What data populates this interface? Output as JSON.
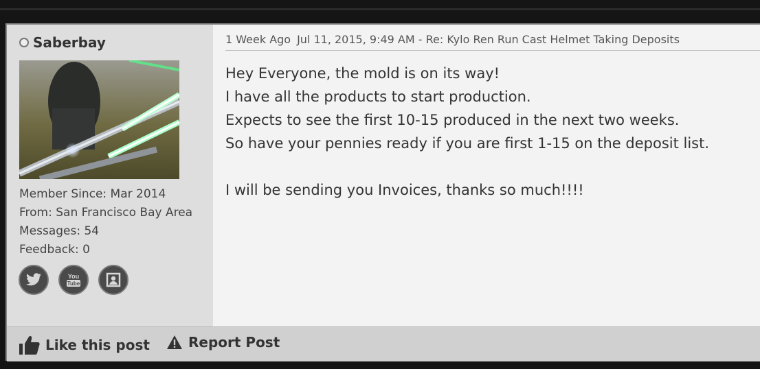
{
  "user": {
    "name": "Saberbay",
    "member_since": "Member Since: Mar 2014",
    "from": "From: San Francisco Bay Area",
    "messages": "Messages: 54",
    "feedback": "Feedback: 0"
  },
  "socials": [
    {
      "icon": "twitter-icon"
    },
    {
      "icon": "youtube-icon"
    },
    {
      "icon": "profile-icon"
    }
  ],
  "post": {
    "age": "1 Week Ago",
    "date": "Jul 11, 2015, 9:49 AM",
    "subject": "- Re: Kylo Ren Run Cast Helmet Taking Deposits",
    "lines": [
      "Hey Everyone, the mold is on its way!",
      "I have all the products to start production.",
      "Expects to see the first 10-15 produced in the next two weeks.",
      "So have your pennies ready if you are first 1-15 on the deposit list.",
      "I will be sending you Invoices, thanks so much!!!!"
    ]
  },
  "footer": {
    "like_label": "Like this post",
    "report_label": "Report Post"
  }
}
